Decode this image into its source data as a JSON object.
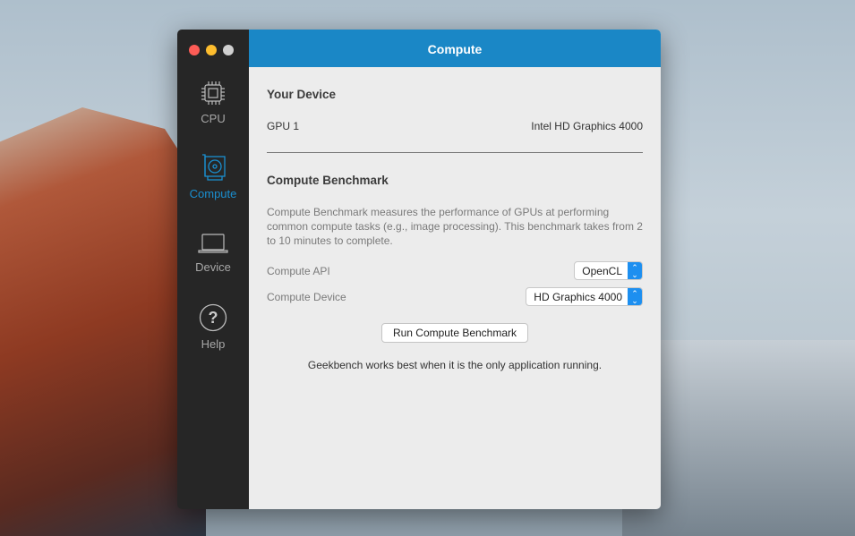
{
  "window": {
    "title": "Compute",
    "traffic_lights": {
      "close": "#fd5c56",
      "minimize": "#fdbd2e",
      "zoom": "#d0d0d0"
    }
  },
  "sidebar": {
    "items": [
      {
        "label": "CPU",
        "icon": "cpu-icon"
      },
      {
        "label": "Compute",
        "icon": "gpu-icon",
        "active": true
      },
      {
        "label": "Device",
        "icon": "laptop-icon"
      },
      {
        "label": "Help",
        "icon": "question-icon"
      }
    ]
  },
  "device": {
    "heading": "Your Device",
    "gpu_label": "GPU 1",
    "gpu_value": "Intel HD Graphics 4000"
  },
  "benchmark": {
    "heading": "Compute Benchmark",
    "description": "Compute Benchmark measures the performance of GPUs at performing common compute tasks (e.g., image processing). This benchmark takes from 2 to 10 minutes to complete.",
    "api_label": "Compute API",
    "api_value": "OpenCL",
    "device_label": "Compute Device",
    "device_value": "HD Graphics 4000",
    "run_button": "Run Compute Benchmark",
    "note": "Geekbench works best when it is the only application running."
  },
  "colors": {
    "accent": "#1a87c6",
    "sidebar": "#262626"
  }
}
